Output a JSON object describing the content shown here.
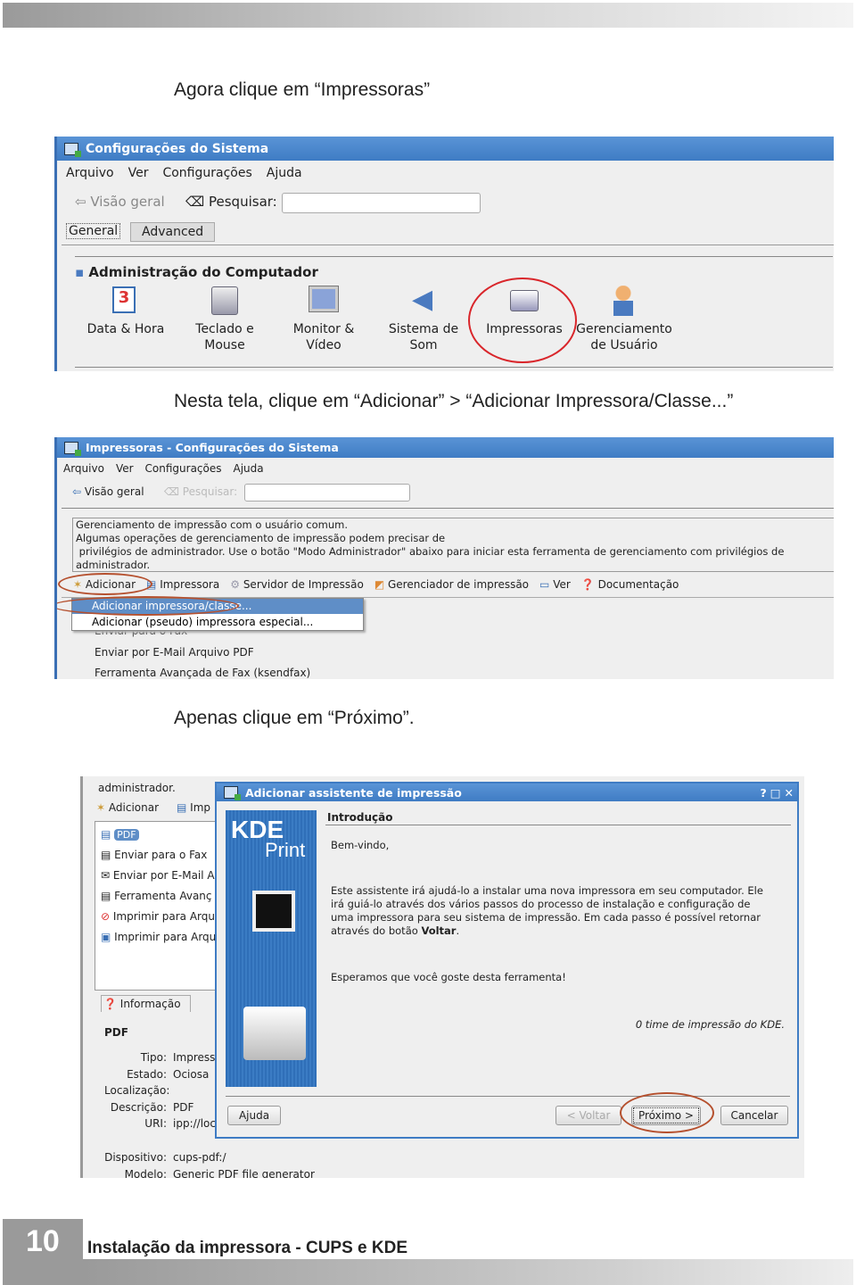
{
  "captions": {
    "step1": "Agora clique em “Impressoras”",
    "step2": "Nesta tela, clique em “Adicionar” > “Adicionar Impressora/Classe...”",
    "step3": "Apenas clique em “Próximo”."
  },
  "shot1": {
    "title": "Configurações do Sistema",
    "menu": [
      "Arquivo",
      "Ver",
      "Configurações",
      "Ajuda"
    ],
    "back": "Visão geral",
    "search_label": "Pesquisar:",
    "search_value": "",
    "tabs": [
      "General",
      "Advanced"
    ],
    "section": "Administração do Computador",
    "items": [
      {
        "l1": "Data & Hora",
        "l2": "",
        "icon": "calendar-icon"
      },
      {
        "l1": "Teclado e",
        "l2": "Mouse",
        "icon": "keyboard-icon"
      },
      {
        "l1": "Monitor &",
        "l2": "Vídeo",
        "icon": "monitor-icon"
      },
      {
        "l1": "Sistema de",
        "l2": "Som",
        "icon": "speaker-icon"
      },
      {
        "l1": "Impressoras",
        "l2": "",
        "icon": "printer-icon"
      },
      {
        "l1": "Gerenciamento",
        "l2": "de Usuário",
        "icon": "user-icon"
      }
    ]
  },
  "shot2": {
    "title": "Impressoras - Configurações do Sistema",
    "menu": [
      "Arquivo",
      "Ver",
      "Configurações",
      "Ajuda"
    ],
    "back": "Visão geral",
    "search_label": "Pesquisar:",
    "info": [
      "Gerenciamento de impressão com o usuário comum.",
      "Algumas operações de gerenciamento de impressão podem precisar de",
      " privilégios de administrador. Use o botão \"Modo Administrador\" abaixo para iniciar esta ferramenta de gerenciamento com privilégios de",
      "administrador."
    ],
    "toolbar": [
      "Adicionar",
      "Impressora",
      "Servidor de Impressão",
      "Gerenciador de impressão",
      "Ver",
      "Documentação"
    ],
    "dropdown": [
      "Adicionar impressora/classe...",
      "Adicionar (pseudo) impressora especial..."
    ],
    "list": [
      "Enviar para o Fax",
      "Enviar por E-Mail Arquivo PDF",
      "Ferramenta Avançada de Fax (ksendfax)"
    ]
  },
  "shot3": {
    "bg": {
      "top_text": "administrador.",
      "toolbar": [
        "Adicionar",
        "Imp"
      ],
      "list": [
        "PDF",
        "Enviar para o Fax",
        "Enviar por E-Mail A",
        "Ferramenta Avanç",
        "Imprimir para Arqu",
        "Imprimir para Arqu"
      ],
      "tab": "Informação",
      "printer_name": "PDF",
      "fields": [
        [
          "Tipo:",
          "Impress"
        ],
        [
          "Estado:",
          "Ociosa"
        ],
        [
          "Localização:",
          ""
        ],
        [
          "Descrição:",
          "PDF"
        ],
        [
          "URI:",
          "ipp://loc"
        ]
      ],
      "fields2": [
        [
          "Dispositivo:",
          "cups-pdf:/"
        ],
        [
          "Modelo:",
          "Generic PDF file generator"
        ]
      ]
    },
    "dialog": {
      "title": "Adicionar assistente de impressão",
      "logo1": "KDE",
      "logo2": "Print",
      "heading": "Introdução",
      "welcome": "Bem-vindo,",
      "body": [
        "Este assistente irá ajudá-lo a instalar uma nova impressora em seu computador. Ele",
        "irá guiá-lo através dos vários passos do processo de instalação e configuração de",
        "uma impressora para seu sistema de impressão. Em cada passo é possível retornar",
        "através do botão "
      ],
      "body_bold": "Voltar",
      "body_end": ".",
      "hope": "Esperamos que você goste desta ferramenta!",
      "team": "0 time de impressão do KDE.",
      "buttons": {
        "help": "Ajuda",
        "back": "< Voltar",
        "next": "Próximo >",
        "cancel": "Cancelar"
      }
    }
  },
  "footer": {
    "page": "10",
    "title": "Instalação da impressora - CUPS e KDE"
  },
  "colors": {
    "titlebar": "#3f7cc4",
    "highlight_ring": "#b5502e",
    "red_circle": "#d9262b"
  }
}
